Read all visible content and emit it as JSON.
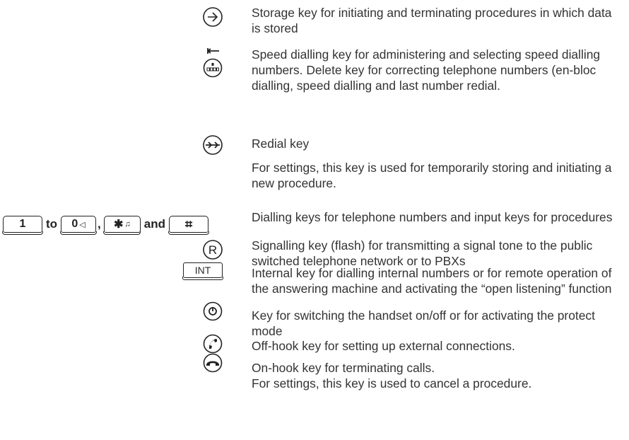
{
  "entries": [
    {
      "icon": "storage-key-icon",
      "text": "Storage key for initiating and terminating procedures in which data is stored"
    },
    {
      "icon": "speed-dial-delete-key-icon",
      "text": "Speed dialling key for administering and selecting speed dialling numbers. Delete key for correcting telephone numbers (en-bloc dialling, speed dialling and last number redial."
    },
    {
      "icon": "redial-key-icon",
      "text": "Redial key"
    },
    {
      "icon": "",
      "text": "For settings, this key is used for temporarily storing and initiating a new procedure."
    },
    {
      "icon": "dialling-keys",
      "text": "Dialling keys for telephone numbers and input keys for procedures"
    },
    {
      "icon": "r-key-icon",
      "text": "Signalling key (flash) for transmitting a signal tone to the public switched telephone network or to PBXs"
    },
    {
      "icon": "int-key-icon",
      "text": "Internal key for dialling internal numbers or for remote operation of the answering machine and activating the “open listening” function"
    },
    {
      "icon": "on-off-key-icon",
      "text": "Key for switching the handset on/off or for activating the protect mode"
    },
    {
      "icon": "off-hook-key-icon",
      "text": "Off-hook key for setting up external connections."
    },
    {
      "icon": "on-hook-key-icon",
      "text": "On-hook key for terminating calls.\nFor settings, this key is used to cancel a procedure."
    }
  ],
  "keys": {
    "key1": "1",
    "to": "to",
    "key0": "0",
    "comma": ",",
    "star": "✱",
    "and": "and",
    "hash": "⌗",
    "r": "R",
    "int": "INT"
  }
}
